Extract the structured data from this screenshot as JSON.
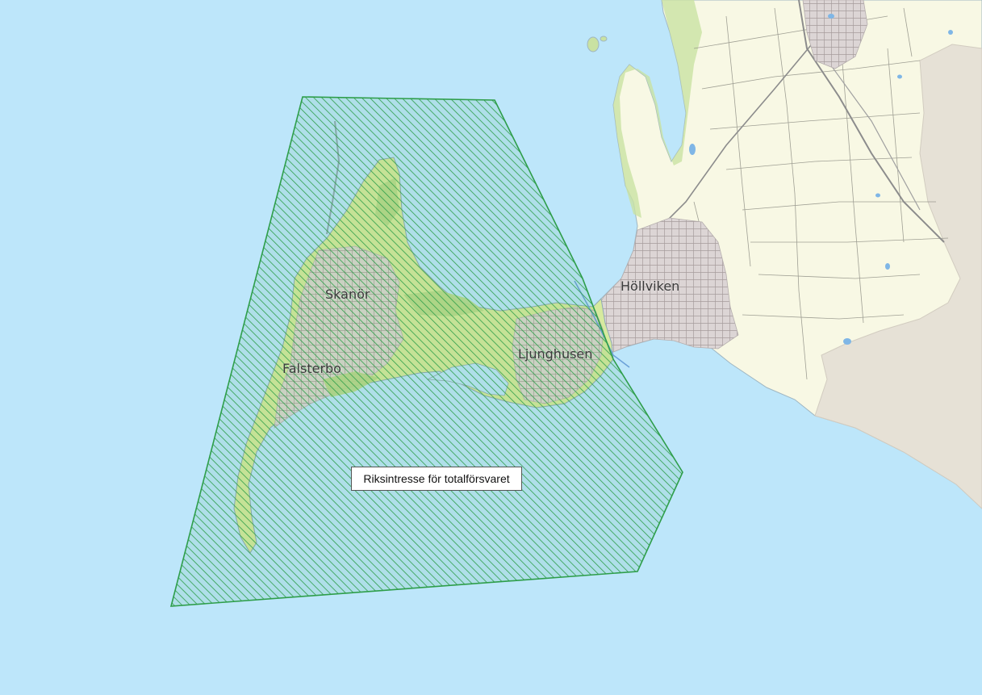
{
  "map": {
    "places": {
      "skanor": "Skanör",
      "falsterbo": "Falsterbo",
      "ljunghusen": "Ljunghusen",
      "hollviken": "Höllviken"
    },
    "zone": {
      "label": "Riksintresse för totalförsvaret",
      "color": "#2e9e4a"
    },
    "colors": {
      "sea": "#bde6fa",
      "land": "#f8f8e4",
      "upland": "#e6e1d6",
      "urban": "#d9d3d3",
      "green": "#c9e2a2"
    }
  }
}
